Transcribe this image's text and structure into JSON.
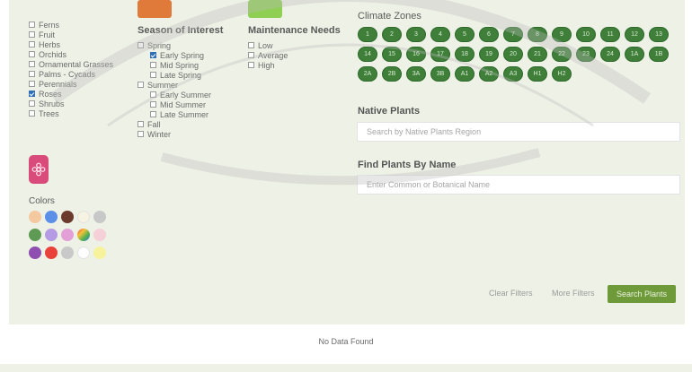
{
  "categories": [
    {
      "label": "Ferns",
      "checked": false
    },
    {
      "label": "Fruit",
      "checked": false
    },
    {
      "label": "Herbs",
      "checked": false
    },
    {
      "label": "Orchids",
      "checked": false
    },
    {
      "label": "Ornamental Grasses",
      "checked": false
    },
    {
      "label": "Palms - Cycads",
      "checked": false
    },
    {
      "label": "Perennials",
      "checked": false
    },
    {
      "label": "Roses",
      "checked": true
    },
    {
      "label": "Shrubs",
      "checked": false
    },
    {
      "label": "Trees",
      "checked": false
    }
  ],
  "colors": {
    "title": "Colors",
    "swatches": [
      "#f5c9a0",
      "#5b8fe8",
      "#6b3a2c",
      "#f7f3e3",
      "#c8c8c8",
      "#5f9a55",
      "#b59be3",
      "#e3a0d6",
      "rainbow",
      "#f5d0d8",
      "#8e4fb0",
      "#e8423a",
      "#c9c9c9",
      "#fdfdfd",
      "#f7f39c"
    ]
  },
  "season": {
    "title": "Season of Interest",
    "items": [
      {
        "label": "Spring",
        "checked": false,
        "indent": 0
      },
      {
        "label": "Early Spring",
        "checked": true,
        "indent": 1
      },
      {
        "label": "Mid Spring",
        "checked": false,
        "indent": 1
      },
      {
        "label": "Late Spring",
        "checked": false,
        "indent": 1
      },
      {
        "label": "Summer",
        "checked": false,
        "indent": 0
      },
      {
        "label": "Early Summer",
        "checked": false,
        "indent": 1
      },
      {
        "label": "Mid Summer",
        "checked": false,
        "indent": 1
      },
      {
        "label": "Late Summer",
        "checked": false,
        "indent": 1
      },
      {
        "label": "Fall",
        "checked": false,
        "indent": 0
      },
      {
        "label": "Winter",
        "checked": false,
        "indent": 0
      }
    ]
  },
  "maintenance": {
    "title": "Maintenance Needs",
    "items": [
      {
        "label": "Low",
        "checked": false
      },
      {
        "label": "Average",
        "checked": false
      },
      {
        "label": "High",
        "checked": false
      }
    ]
  },
  "climate": {
    "title": "Climate Zones",
    "zones": [
      "1",
      "2",
      "3",
      "4",
      "5",
      "6",
      "7",
      "8",
      "9",
      "10",
      "11",
      "12",
      "13",
      "14",
      "15",
      "16",
      "17",
      "18",
      "19",
      "20",
      "21",
      "22",
      "23",
      "24",
      "1A",
      "1B",
      "2A",
      "2B",
      "3A",
      "3B",
      "A1",
      "A2",
      "A3",
      "H1",
      "H2"
    ]
  },
  "native_plants": {
    "label": "Native Plants",
    "placeholder": "Search by Native Plants Region"
  },
  "find_by_name": {
    "label": "Find Plants By Name",
    "placeholder": "Enter Common or Botanical Name"
  },
  "actions": {
    "clear": "Clear Filters",
    "more": "More Filters",
    "search": "Search Plants"
  },
  "results": {
    "empty_text": "No Data Found"
  },
  "theme": {
    "panel_bg": "#eef1e6",
    "accent_green": "#6f9a3a",
    "zone_green": "#3f7f3a",
    "flower_pink": "#d94b7a"
  }
}
